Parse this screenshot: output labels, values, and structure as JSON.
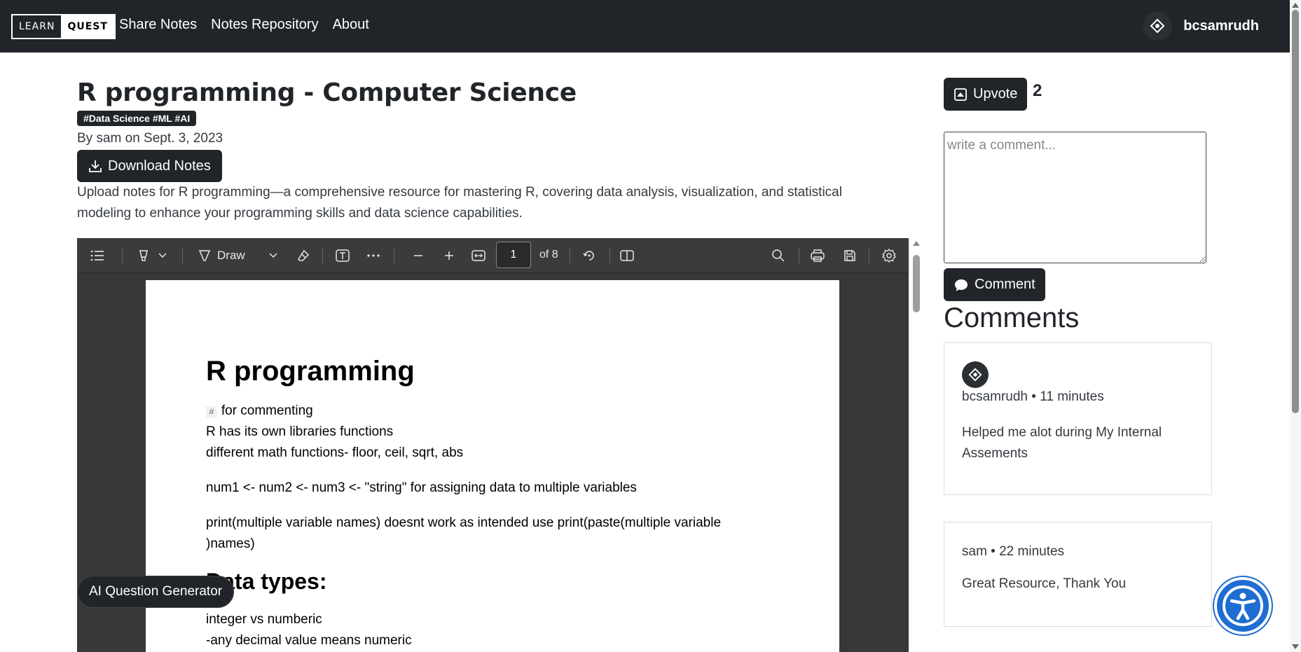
{
  "navbar": {
    "logo_left": "LEARN",
    "logo_right": "QUEST",
    "links": [
      "Share Notes",
      "Notes Repository",
      "About"
    ],
    "username": "bcsamrudh"
  },
  "note": {
    "title": "R programming - Computer Science",
    "tags": "#Data Science #ML #AI",
    "byline": "By sam on Sept. 3, 2023",
    "download_label": "Download Notes",
    "description": "Upload notes for R programming—a comprehensive resource for mastering R, covering data analysis, visualization, and statistical modeling to enhance your programming skills and data science capabilities."
  },
  "viewer": {
    "draw_label": "Draw",
    "page_number": "1",
    "page_total": "of 8"
  },
  "pdf": {
    "heading": "R programming",
    "code_hash": "#",
    "line1": "for commenting",
    "line2": "R has its own libraries functions",
    "line3": "different math functions- floor, ceil, sqrt, abs",
    "line4": "num1 <- num2 <- num3 <- \"string\" for assigning data to multiple variables",
    "line5a": "print(multiple variable names) doesnt work as intended use print(paste(multiple variable",
    "line5b": ")names)",
    "heading2": "Data types:",
    "line6": "integer vs numberic",
    "line7": "-any decimal value means numeric"
  },
  "ai_button_label": "AI Question Generator",
  "sidebar": {
    "upvote_label": "Upvote",
    "upvote_count": "2",
    "comment_placeholder": "write a comment...",
    "comment_button": "Comment",
    "comments_heading": "Comments",
    "comments": [
      {
        "author_time": "bcsamrudh • 11 minutes",
        "text": "Helped me alot during My Internal Assements"
      },
      {
        "author_time": "sam • 22 minutes",
        "text": "Great Resource, Thank You"
      }
    ]
  },
  "colors": {
    "navbar_bg": "#212529",
    "button_bg": "#212529",
    "viewer_bg": "#383838",
    "accessibility_blue": "#1e6dd2"
  }
}
